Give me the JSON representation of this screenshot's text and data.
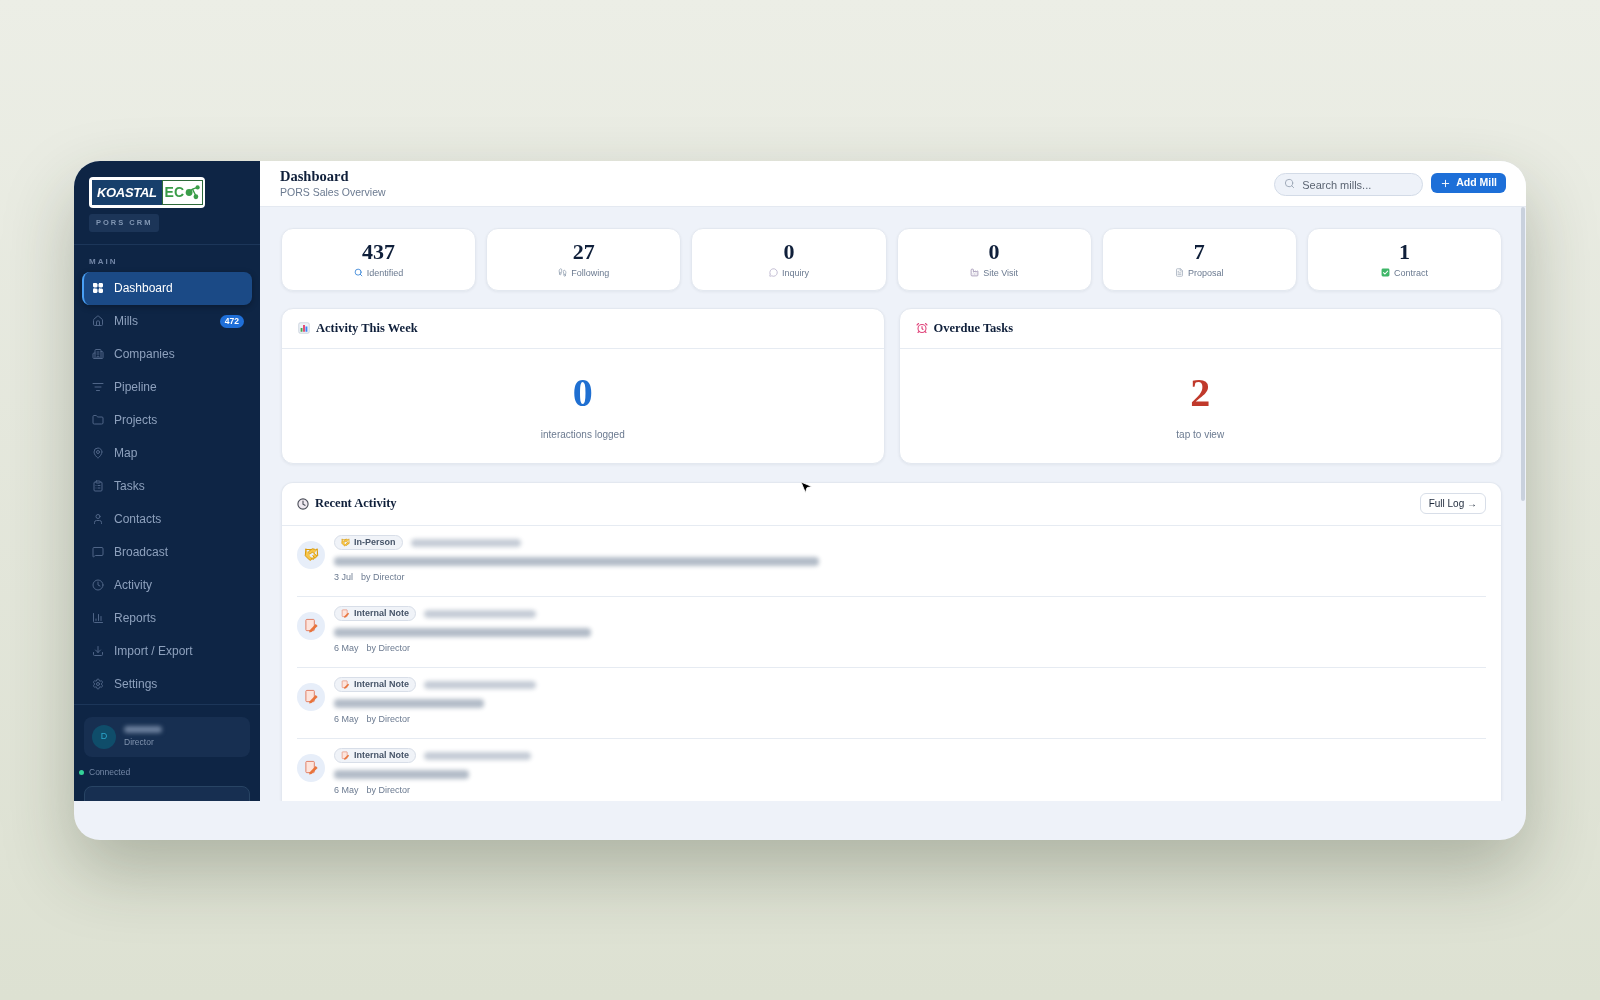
{
  "sidebar": {
    "logo": {
      "word": "KOASTAL",
      "mark": "EC"
    },
    "product_tag": "PORS CRM",
    "section_label": "MAIN",
    "items": [
      {
        "label": "Dashboard",
        "selected": true
      },
      {
        "label": "Mills",
        "selected": false,
        "badge": "472"
      },
      {
        "label": "Companies",
        "selected": false
      },
      {
        "label": "Pipeline",
        "selected": false
      },
      {
        "label": "Projects",
        "selected": false
      },
      {
        "label": "Map",
        "selected": false
      },
      {
        "label": "Tasks",
        "selected": false
      },
      {
        "label": "Contacts",
        "selected": false
      },
      {
        "label": "Broadcast",
        "selected": false
      },
      {
        "label": "Activity",
        "selected": false
      },
      {
        "label": "Reports",
        "selected": false
      },
      {
        "label": "Import / Export",
        "selected": false
      },
      {
        "label": "Settings",
        "selected": false
      }
    ],
    "user": {
      "avatar_initial": "D",
      "role": "Director"
    },
    "connection": {
      "label": "Connected",
      "connected": true
    }
  },
  "header": {
    "title": "Dashboard",
    "subtitle": "PORS Sales Overview",
    "search": {
      "placeholder": "Search mills..."
    },
    "add_button": "Add Mill"
  },
  "stats": [
    {
      "value": "437",
      "label": "Identified"
    },
    {
      "value": "27",
      "label": "Following"
    },
    {
      "value": "0",
      "label": "Inquiry"
    },
    {
      "value": "0",
      "label": "Site Visit"
    },
    {
      "value": "7",
      "label": "Proposal"
    },
    {
      "value": "1",
      "label": "Contract"
    }
  ],
  "widgets": [
    {
      "title": "Activity This Week",
      "value": "0",
      "caption": "interactions logged",
      "color": "#1f6fd1"
    },
    {
      "title": "Overdue Tasks",
      "value": "2",
      "caption": "tap to view",
      "color": "#c0392b"
    }
  ],
  "recent_activity": {
    "title": "Recent Activity",
    "button": "Full Log →",
    "entries": [
      {
        "kind": "in-person",
        "tag": "In-Person",
        "date": "3 Jul",
        "author": "by Director"
      },
      {
        "kind": "note",
        "tag": "Internal Note",
        "date": "6 May",
        "author": "by Director"
      },
      {
        "kind": "note",
        "tag": "Internal Note",
        "date": "6 May",
        "author": "by Director"
      },
      {
        "kind": "note",
        "tag": "Internal Note",
        "date": "6 May",
        "author": "by Director"
      }
    ]
  }
}
